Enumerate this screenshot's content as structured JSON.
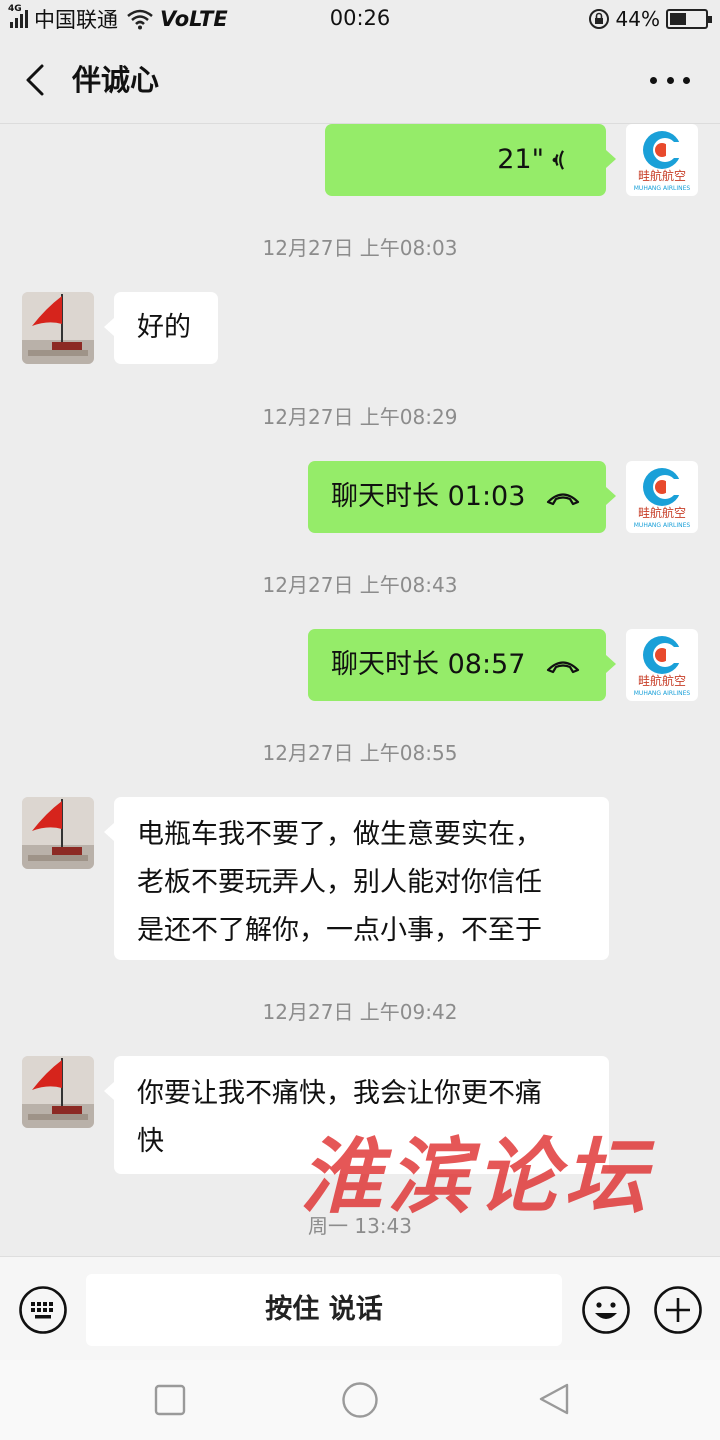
{
  "status_bar": {
    "network": "4G",
    "carrier": "中国联通",
    "volte": "VoLTE",
    "time": "00:26",
    "battery": "44%",
    "battery_level": 0.44
  },
  "header": {
    "back_icon": "chevron-left-icon",
    "title": "伴诚心",
    "more_icon": "more-horizontal-icon"
  },
  "messages": {
    "voice": {
      "duration": "21\"",
      "icon": "voice-wave-icon"
    },
    "ts1": "12月27日 上午08:03",
    "m1_text": "好的",
    "ts2": "12月27日 上午08:29",
    "call1": {
      "text": "聊天时长 01:03",
      "icon": "phone-hangup-icon"
    },
    "ts3": "12月27日 上午08:43",
    "call2": {
      "text": "聊天时长 08:57",
      "icon": "phone-hangup-icon"
    },
    "ts4": "12月27日 上午08:55",
    "m2_text": [
      "电瓶车我不要了，做生意要实在，",
      "老板不要玩弄人，别人能对你信任",
      "是还不了解你，一点小事，不至于"
    ],
    "ts5": "12月27日 上午09:42",
    "m3_text": [
      "你要让我不痛快，我会让你更不痛",
      "快"
    ],
    "ts6": "周一 13:43"
  },
  "avatars": {
    "me_logo_text": "畦航航空",
    "me_logo_sub": "MUHANG AIRLINES"
  },
  "watermark": "淮滨论坛",
  "input_bar": {
    "keyboard_icon": "keyboard-icon",
    "talk_label": "按住 说话",
    "emoji_icon": "emoji-icon",
    "plus_icon": "plus-circle-icon"
  },
  "system_nav": {
    "recent_icon": "square-icon",
    "home_icon": "circle-icon",
    "back_icon": "triangle-back-icon"
  },
  "colors": {
    "bubble_me": "#95ec69",
    "bubble_other": "#ffffff",
    "background": "#ededed",
    "watermark": "#de2828"
  }
}
